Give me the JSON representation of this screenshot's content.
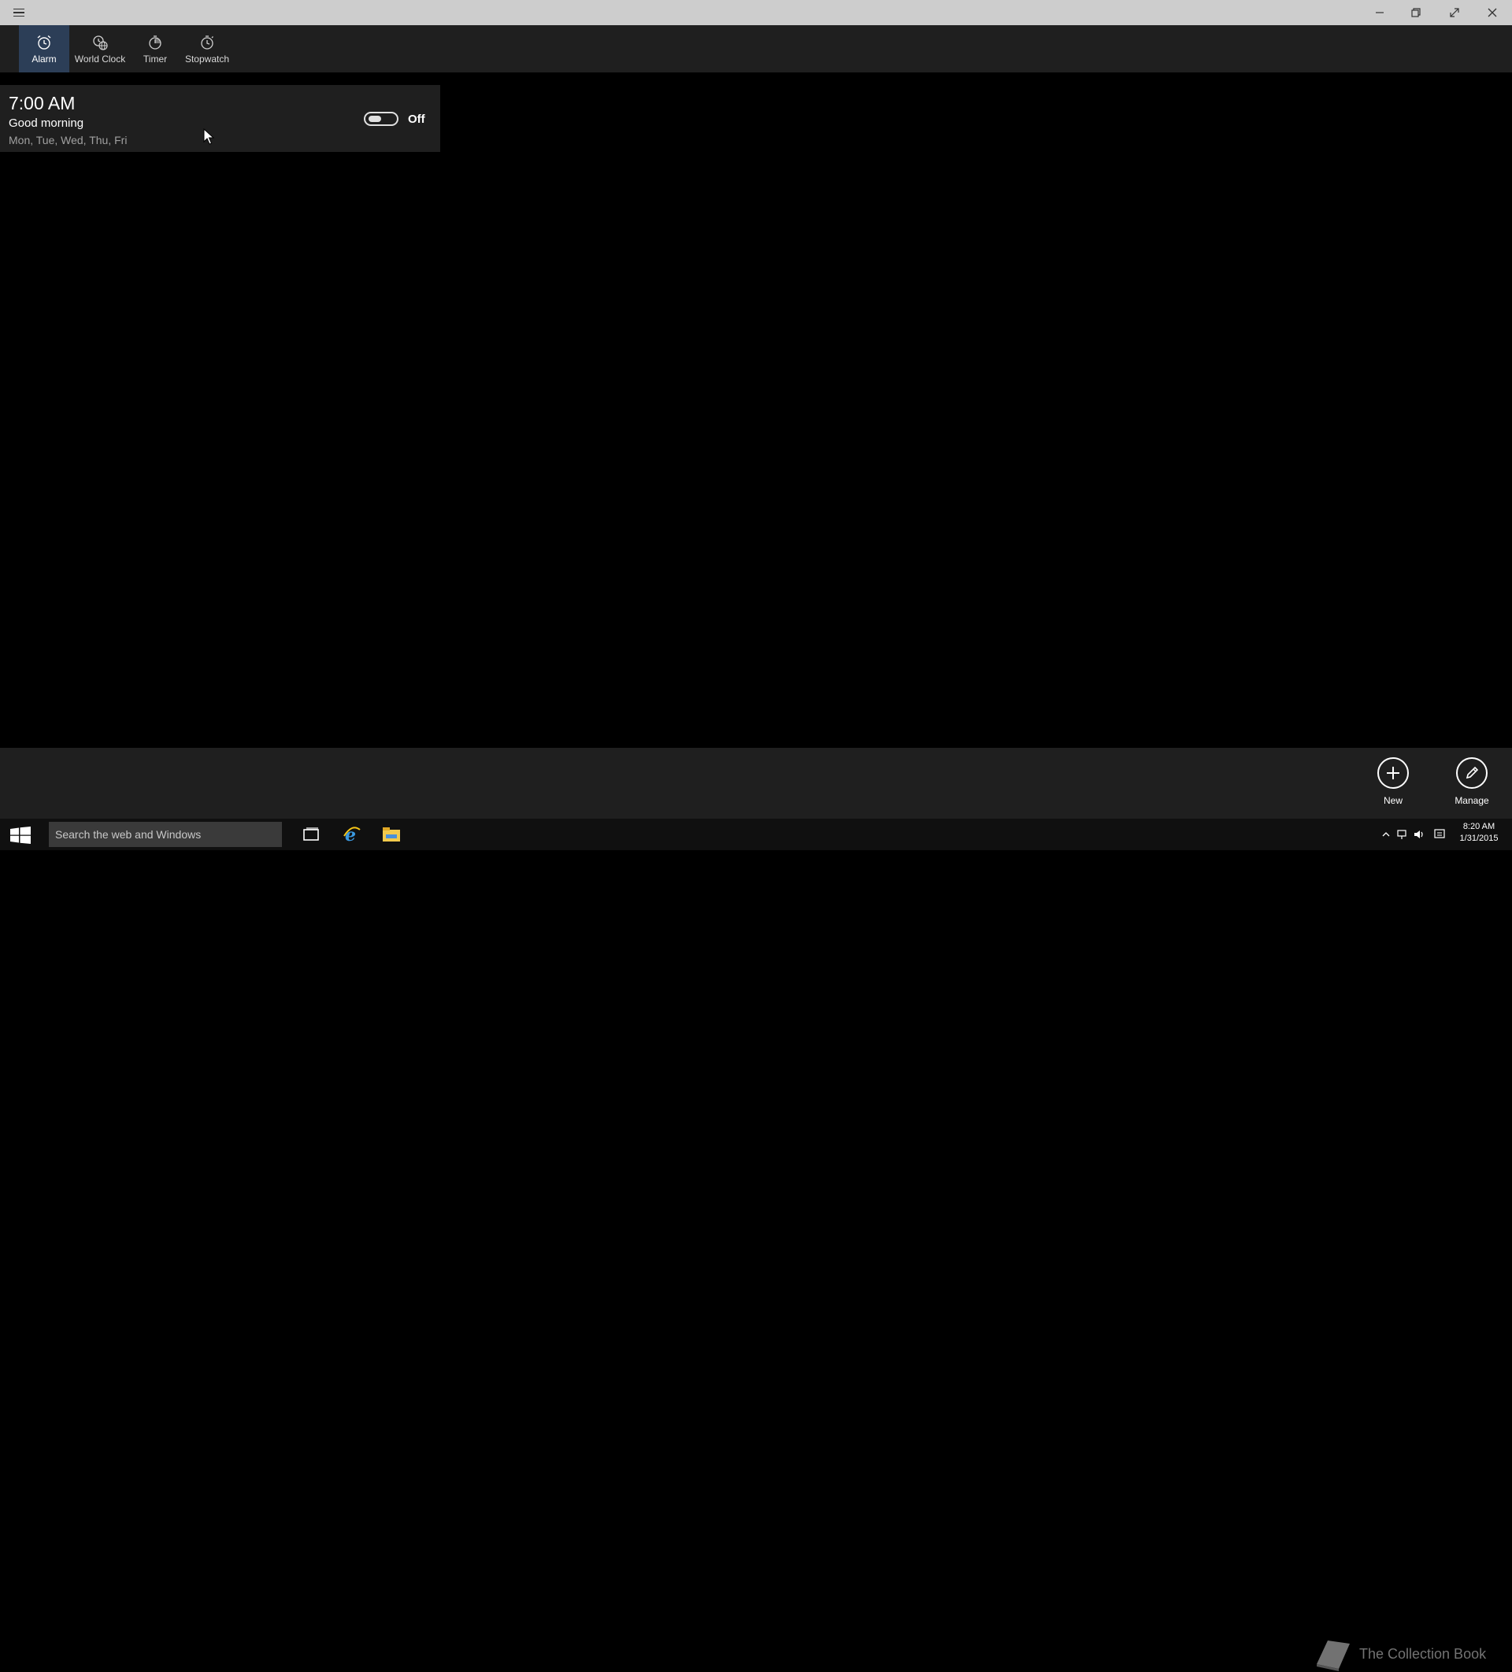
{
  "window": {
    "controls": {
      "minimize_icon": "minimize-icon",
      "restore_icon": "restore-icon",
      "fullscreen_icon": "fullscreen-icon",
      "close_icon": "close-icon"
    }
  },
  "tabs": [
    {
      "label": "Alarm",
      "icon": "alarm-clock-icon",
      "active": true
    },
    {
      "label": "World Clock",
      "icon": "globe-clock-icon",
      "active": false
    },
    {
      "label": "Timer",
      "icon": "timer-icon",
      "active": false
    },
    {
      "label": "Stopwatch",
      "icon": "stopwatch-icon",
      "active": false
    }
  ],
  "alarms": [
    {
      "time": "7:00 AM",
      "name": "Good morning",
      "days": "Mon, Tue, Wed, Thu, Fri",
      "state_label": "Off",
      "enabled": false
    }
  ],
  "commands": {
    "new_label": "New",
    "manage_label": "Manage"
  },
  "taskbar": {
    "search_placeholder": "Search the web and Windows",
    "watermark": "The Collection Book",
    "clock_time": "8:20 AM",
    "clock_date": "1/31/2015"
  },
  "colors": {
    "titlebar": "#cdcdcd",
    "navbar": "#1f1f1f",
    "active_tab": "#2c3e57",
    "background": "#000000",
    "taskbar": "#101010"
  }
}
